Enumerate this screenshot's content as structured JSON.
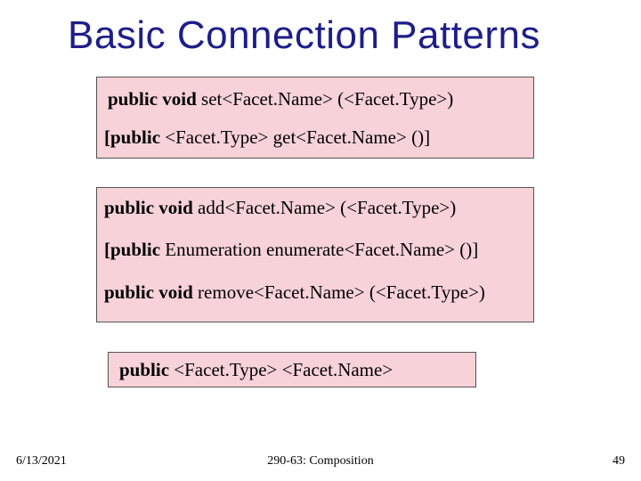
{
  "title": "Basic Connection Patterns",
  "box1": {
    "line1_pre": "public void",
    "line1_rest": " set<Facet.Name> (<Facet.Type>)",
    "line2_pre": "[public",
    "line2_rest": " <Facet.Type>  get<Facet.Name> ()]"
  },
  "box2": {
    "line1_pre": "public void",
    "line1_rest": " add<Facet.Name> (<Facet.Type>)",
    "line2_pre": "[public",
    "line2_rest": " Enumeration  enumerate<Facet.Name> ()]",
    "line3_pre": "public void",
    "line3_rest": " remove<Facet.Name> (<Facet.Type>)"
  },
  "box3": {
    "line1_pre": "public",
    "line1_rest": " <Facet.Type>  <Facet.Name>"
  },
  "footer": {
    "date": "6/13/2021",
    "center": "290-63: Composition",
    "page": "49"
  }
}
